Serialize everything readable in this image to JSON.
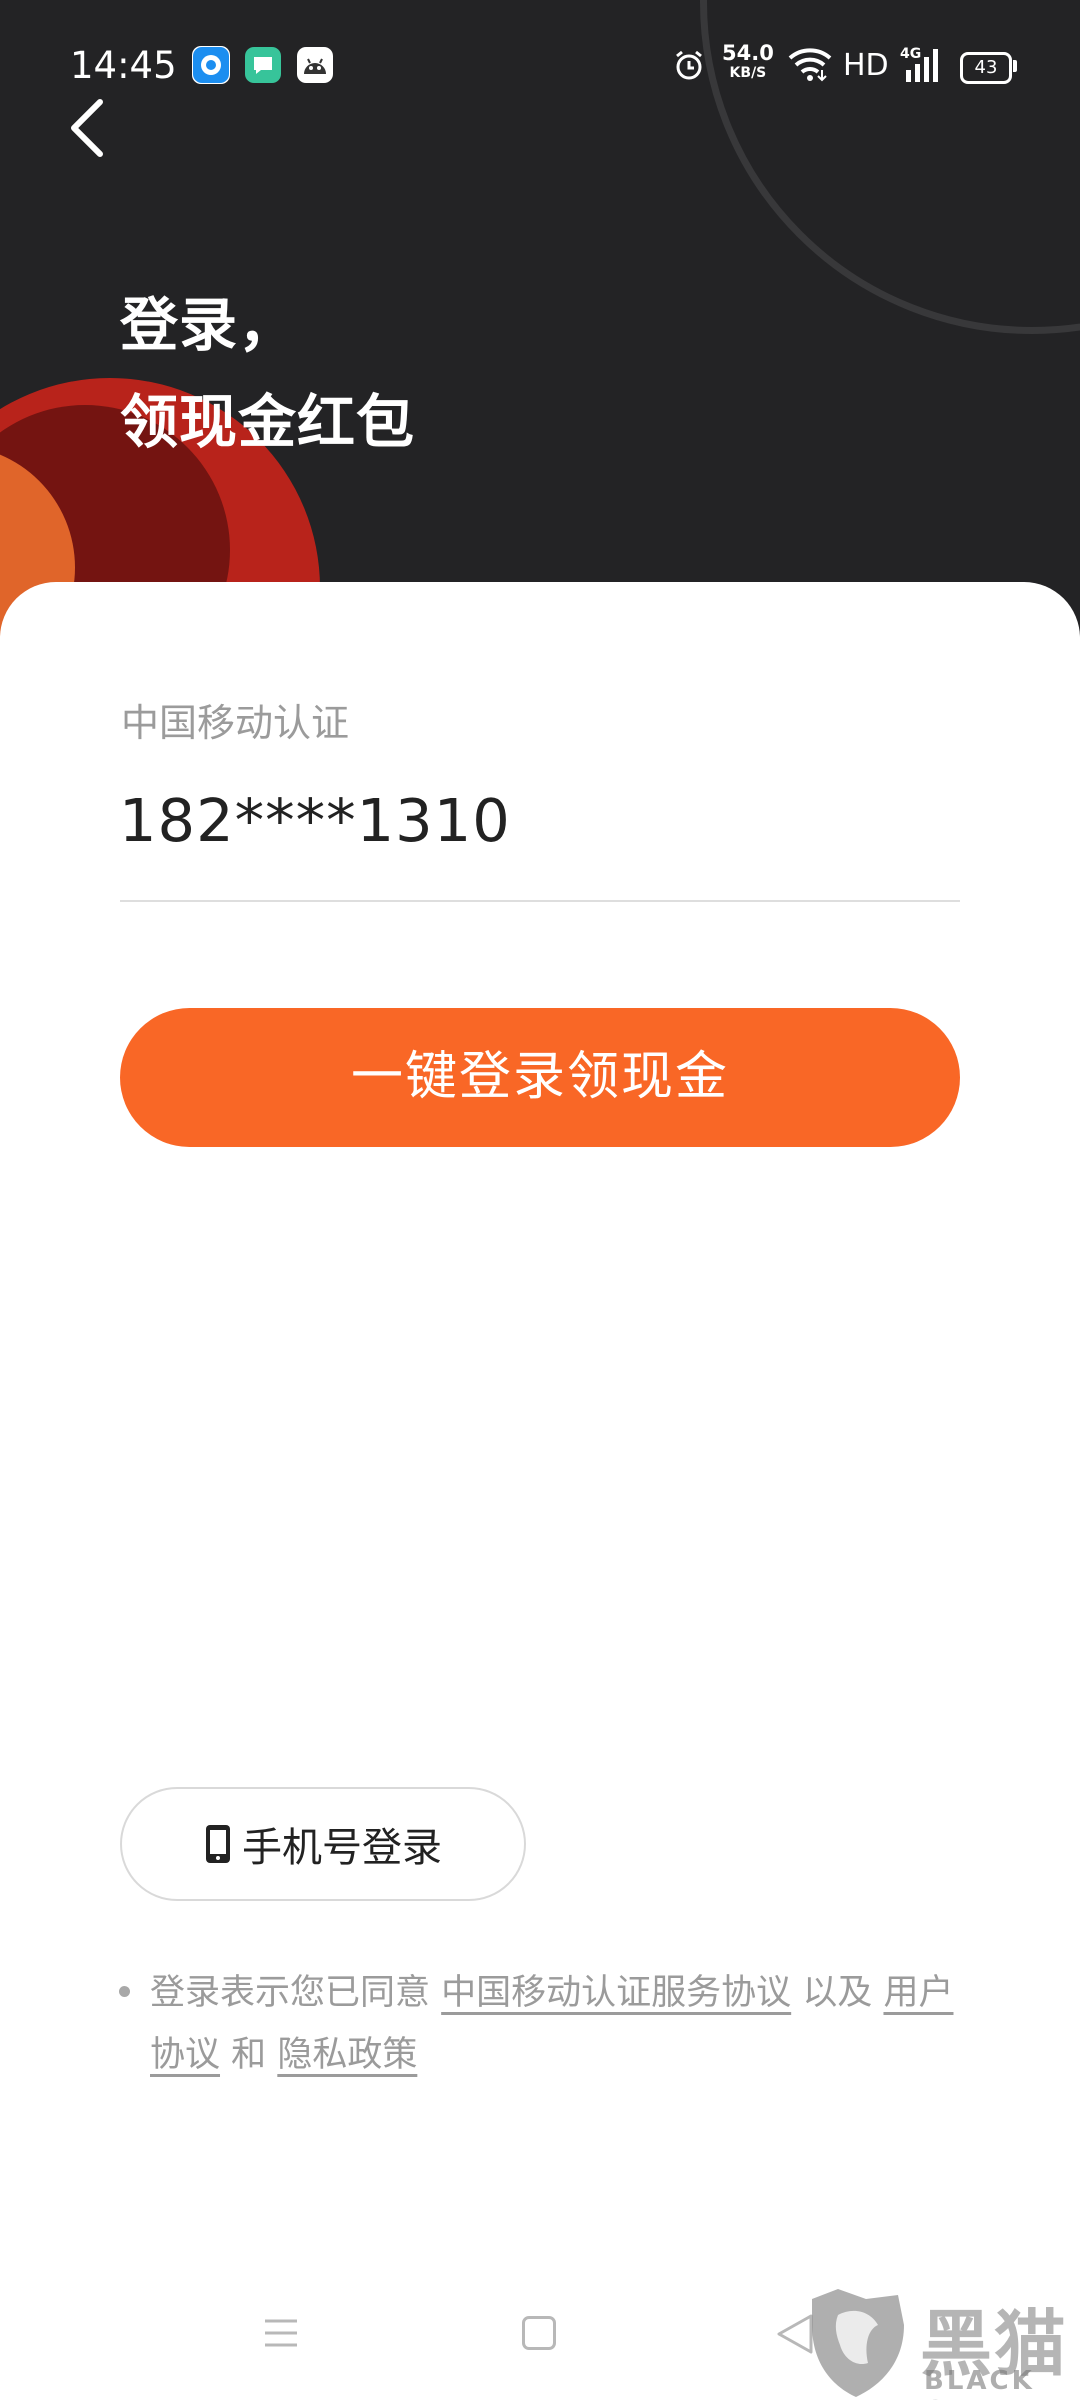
{
  "status_bar": {
    "time": "14:45",
    "net_speed_value": "54.0",
    "net_speed_unit": "KB/S",
    "hd": "HD",
    "network_type": "4G",
    "battery": "43",
    "icons": [
      "notification-app-icon",
      "message-app-icon",
      "robot-app-icon",
      "alarm-icon",
      "wifi-icon",
      "signal-icon",
      "battery-icon"
    ]
  },
  "header": {
    "line1": "登录，",
    "line2": "领现金红包",
    "colors": {
      "background": "#232325",
      "accent_red": "#b8231b",
      "accent_dark_red": "#741411",
      "accent_orange": "#e0652a"
    }
  },
  "auth": {
    "provider_label": "中国移动认证",
    "phone_number": "182****1310"
  },
  "buttons": {
    "one_key_login": "一键登录领现金",
    "phone_login": "手机号登录",
    "primary_color": "#f96726"
  },
  "agreement": {
    "prefix": "登录表示您已同意",
    "link1": "中国移动认证服务协议",
    "connector1": "以及",
    "link2": "用户协议",
    "connector2": "和",
    "link3": "隐私政策"
  },
  "nav": {
    "icons": [
      "menu-icon",
      "home-icon",
      "back-icon"
    ]
  },
  "watermark": {
    "cn": "黑猫",
    "en": "BLACK CAT"
  }
}
